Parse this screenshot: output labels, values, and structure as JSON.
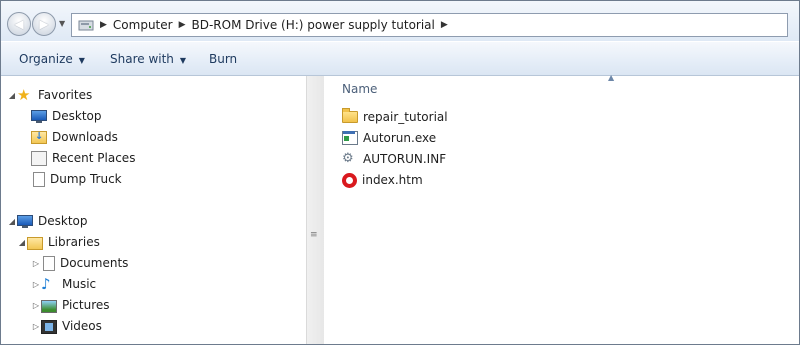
{
  "address": {
    "crumbs": [
      "Computer",
      "BD-ROM Drive (H:) power supply tutorial"
    ],
    "icon": "bd-rom-drive-icon"
  },
  "toolbar": {
    "organize": "Organize",
    "share_with": "Share with",
    "burn": "Burn"
  },
  "nav": {
    "favorites": {
      "label": "Favorites",
      "items": [
        {
          "label": "Desktop",
          "icon": "desktop-icon"
        },
        {
          "label": "Downloads",
          "icon": "downloads-icon"
        },
        {
          "label": "Recent Places",
          "icon": "recent-places-icon"
        },
        {
          "label": "Dump Truck",
          "icon": "document-icon"
        }
      ]
    },
    "desktop": "Desktop",
    "libraries": {
      "label": "Libraries",
      "items": [
        {
          "label": "Documents",
          "icon": "documents-icon"
        },
        {
          "label": "Music",
          "icon": "music-icon"
        },
        {
          "label": "Pictures",
          "icon": "pictures-icon"
        },
        {
          "label": "Videos",
          "icon": "videos-icon"
        }
      ]
    }
  },
  "content": {
    "column_header": "Name",
    "files": [
      {
        "name": "repair_tutorial",
        "icon": "folder-icon"
      },
      {
        "name": "Autorun.exe",
        "icon": "exe-icon"
      },
      {
        "name": "AUTORUN.INF",
        "icon": "settings-file-icon"
      },
      {
        "name": "index.htm",
        "icon": "opera-icon"
      }
    ]
  }
}
